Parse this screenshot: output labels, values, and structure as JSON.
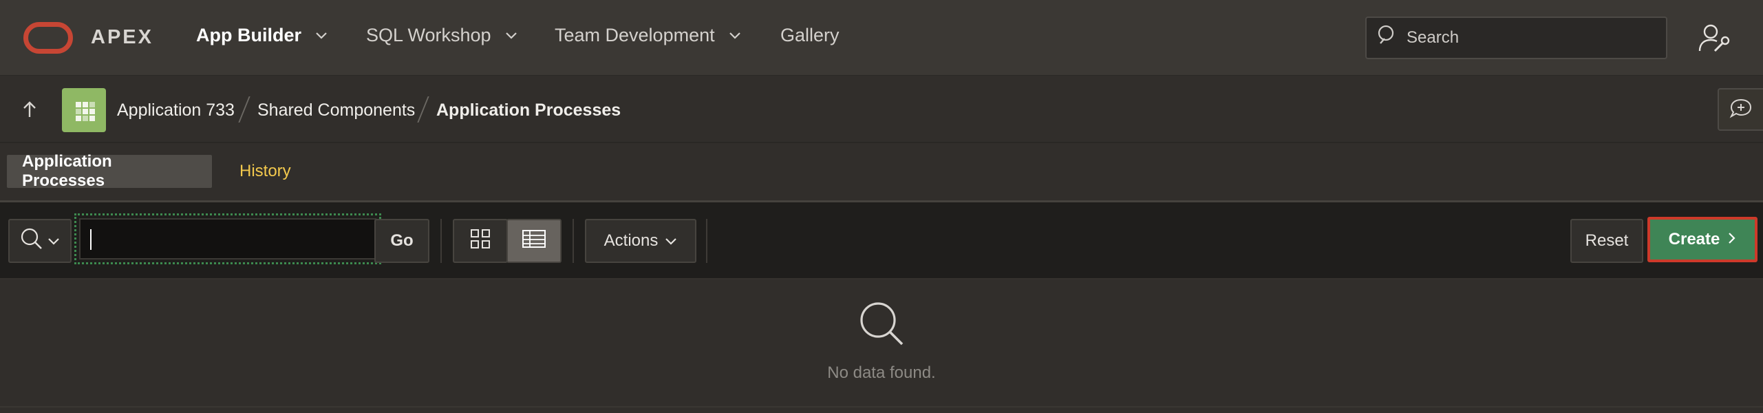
{
  "header": {
    "brand": "APEX",
    "nav": [
      {
        "label": "App Builder",
        "active": true,
        "has_menu": true
      },
      {
        "label": "SQL Workshop",
        "active": false,
        "has_menu": true
      },
      {
        "label": "Team Development",
        "active": false,
        "has_menu": true
      },
      {
        "label": "Gallery",
        "active": false,
        "has_menu": false
      }
    ],
    "search_placeholder": "Search"
  },
  "breadcrumb": {
    "items": [
      "Application 733",
      "Shared Components",
      "Application Processes"
    ]
  },
  "tabs": [
    {
      "label": "Application Processes",
      "active": true
    },
    {
      "label": "History",
      "active": false
    }
  ],
  "toolbar": {
    "search_value": "",
    "go_label": "Go",
    "actions_label": "Actions",
    "reset_label": "Reset",
    "create_label": "Create",
    "view_mode": "report"
  },
  "empty_state": {
    "message": "No data found."
  },
  "colors": {
    "brand_red": "#c74634",
    "create_green": "#3f8556",
    "tab_link_yellow": "#f3c94d",
    "app_icon_green": "#8fb864"
  }
}
